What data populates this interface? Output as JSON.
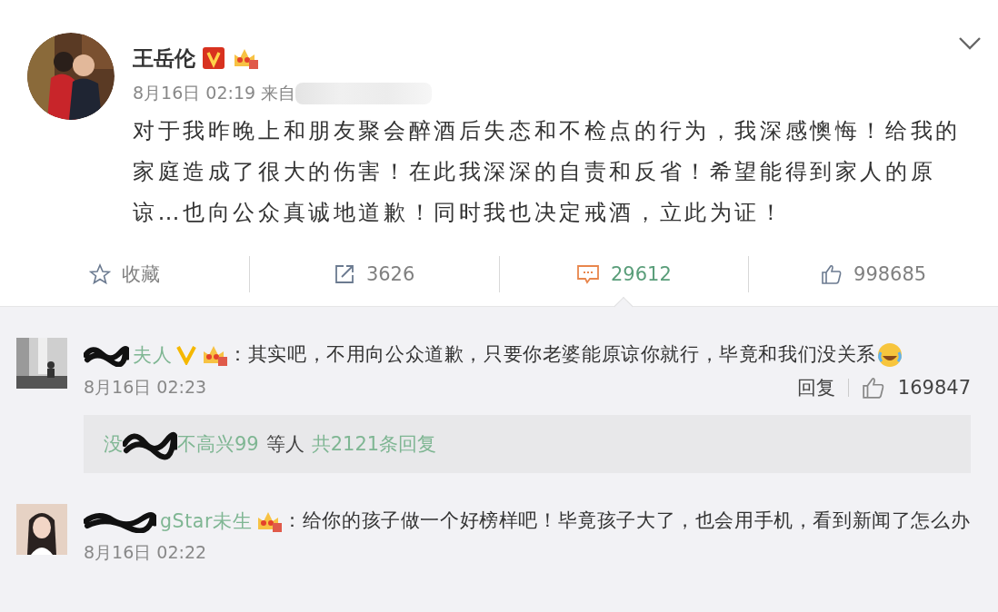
{
  "post": {
    "author": "王岳伦",
    "time": "8月16日 02:19 来自",
    "text": "对于我昨晚上和朋友聚会醉酒后失态和不检点的行为，我深感懊悔！给我的家庭造成了很大的伤害！在此我深深的自责和反省！希望能得到家人的原谅…也向公众真诚地道歉！同时我也决定戒酒，立此为证！"
  },
  "actions": [
    {
      "kind": "star",
      "label": "收藏",
      "selected": false
    },
    {
      "kind": "share",
      "label": "3626",
      "selected": false
    },
    {
      "kind": "comment",
      "label": "29612",
      "selected": true
    },
    {
      "kind": "like",
      "label": "998685",
      "selected": false
    }
  ],
  "comments": [
    {
      "name": "夫人",
      "verified": true,
      "text": "：其实吧，不用向公众道歉，只要你老婆能原谅你就行，毕竟和我们没关系",
      "emoji": true,
      "time": "8月16日 02:23",
      "reply": "回复",
      "likes": "169847",
      "replies": {
        "name_a": "没",
        "name_b": "不高兴99",
        "others": "等人",
        "total": "共2121条回复"
      }
    },
    {
      "name": "gStar未生",
      "verified": false,
      "text": "：给你的孩子做一个好榜样吧！毕竟孩子大了，也会用手机，看到新闻了怎么办",
      "emoji": false,
      "time": "8月16日 02:22"
    }
  ]
}
